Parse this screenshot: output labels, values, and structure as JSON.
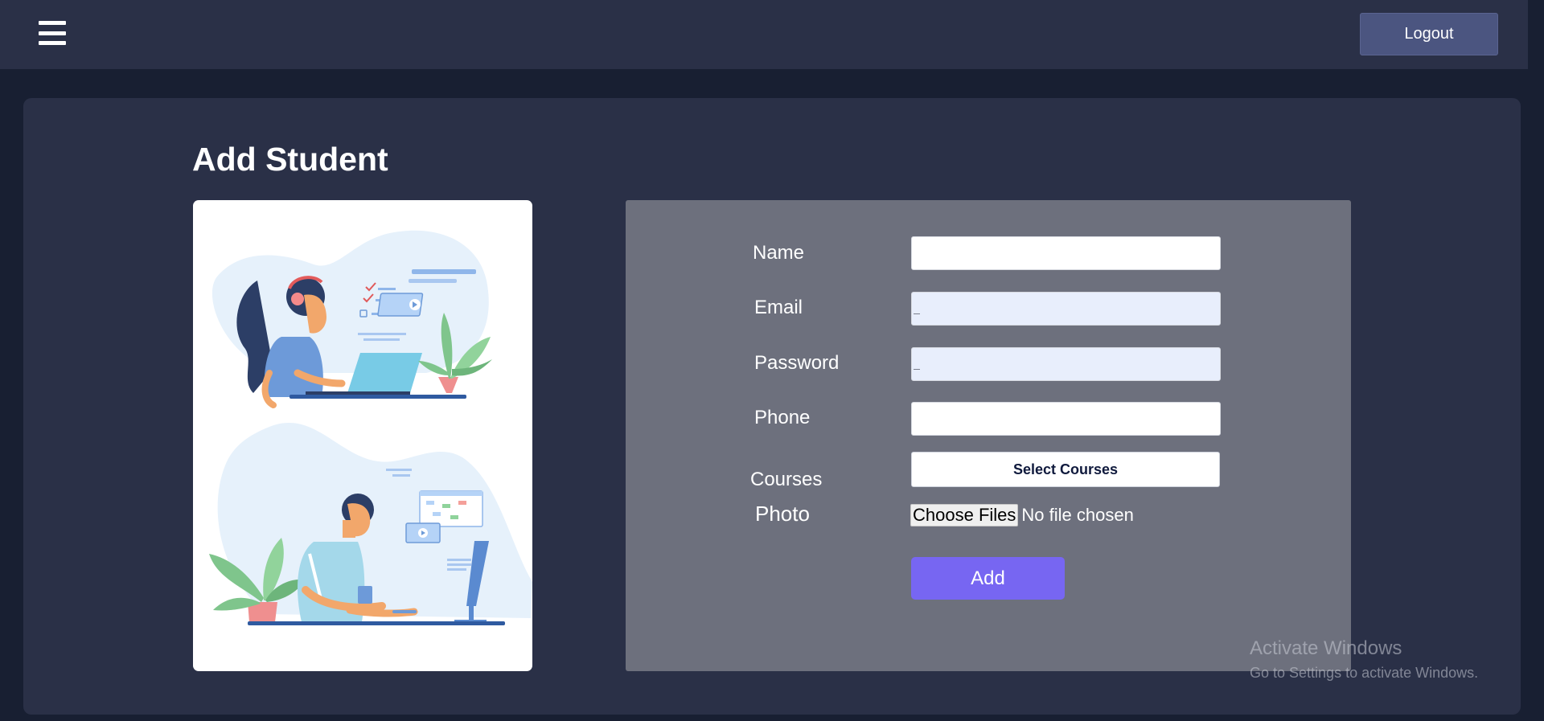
{
  "header": {
    "menu_icon": "hamburger-menu-icon",
    "logout_label": "Logout"
  },
  "page": {
    "title": "Add Student"
  },
  "illustration": {
    "scenes": [
      "woman-with-headphones-on-laptop-illustration",
      "man-at-desktop-computer-illustration"
    ]
  },
  "form": {
    "name_label": "Name",
    "name_value": "",
    "email_label": "Email",
    "email_value": "",
    "password_label": "Password",
    "password_value": "",
    "phone_label": "Phone",
    "phone_value": "",
    "courses_label": "Courses",
    "select_courses_label": "Select Courses",
    "photo_label": "Photo",
    "choose_files_label": "Choose Files",
    "no_file_text": "No file chosen",
    "add_label": "Add"
  },
  "watermark": {
    "title": "Activate Windows",
    "subtitle": "Go to Settings to activate Windows."
  },
  "colors": {
    "background": "#181f32",
    "surface": "#2a3047",
    "form_panel": "#6d707d",
    "logout_button": "#4b5580",
    "add_button": "#7766f2"
  }
}
